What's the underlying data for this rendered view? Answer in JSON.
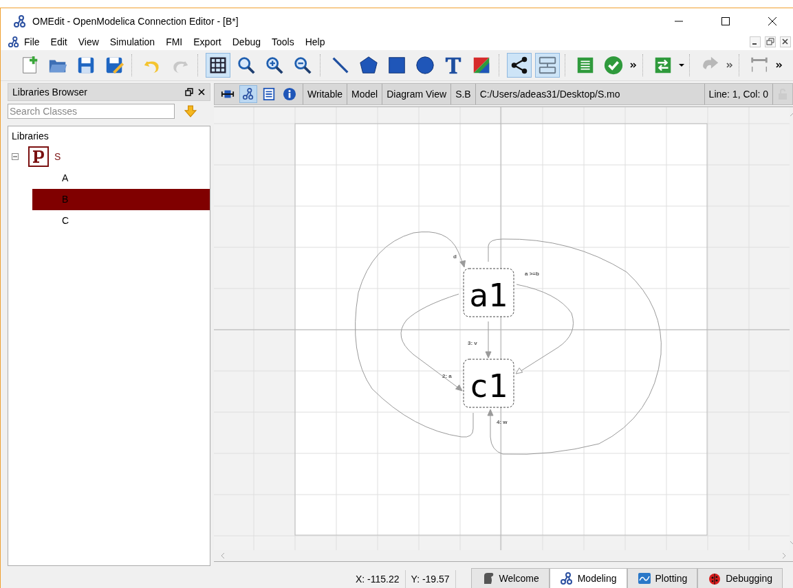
{
  "window": {
    "title": "OMEdit - OpenModelica Connection Editor - [B*]"
  },
  "menu": [
    "File",
    "Edit",
    "View",
    "Simulation",
    "FMI",
    "Export",
    "Debug",
    "Tools",
    "Help"
  ],
  "toolbar": {
    "grid_on": true,
    "connect_mode": true,
    "transition_mode": true
  },
  "libraries_browser": {
    "title": "Libraries Browser",
    "search": {
      "placeholder": "Search Classes"
    },
    "header": "Libraries",
    "tree": [
      {
        "label": "S",
        "expanded": true,
        "selected": false,
        "children": [
          {
            "label": "A",
            "selected": false
          },
          {
            "label": "B",
            "selected": true
          },
          {
            "label": "C",
            "selected": false
          }
        ]
      }
    ]
  },
  "model_toolbar": {
    "view_buttons": [
      {
        "kind": "icon",
        "selected": false
      },
      {
        "kind": "diagram",
        "selected": true
      },
      {
        "kind": "text",
        "selected": false
      },
      {
        "kind": "info",
        "selected": false
      }
    ],
    "fields": [
      "Writable",
      "Model",
      "Diagram View",
      "S.B",
      "C:/Users/adeas31/Desktop/S.mo"
    ],
    "cursor": "Line: 1, Col: 0"
  },
  "diagram": {
    "states": [
      {
        "name": "a1"
      },
      {
        "name": "c1"
      }
    ],
    "transitions": [
      {
        "label": "d"
      },
      {
        "label": "a >=b"
      },
      {
        "label": "3: v"
      },
      {
        "label": "2: a"
      },
      {
        "label": "4: w"
      }
    ]
  },
  "status_bar": {
    "x": "X: -115.22",
    "y": "Y: -19.57",
    "perspectives": [
      {
        "label": "Welcome",
        "kind": "welcome",
        "selected": false
      },
      {
        "label": "Modeling",
        "kind": "modeling",
        "selected": true
      },
      {
        "label": "Plotting",
        "kind": "plotting",
        "selected": false
      },
      {
        "label": "Debugging",
        "kind": "debugging",
        "selected": false
      }
    ]
  }
}
